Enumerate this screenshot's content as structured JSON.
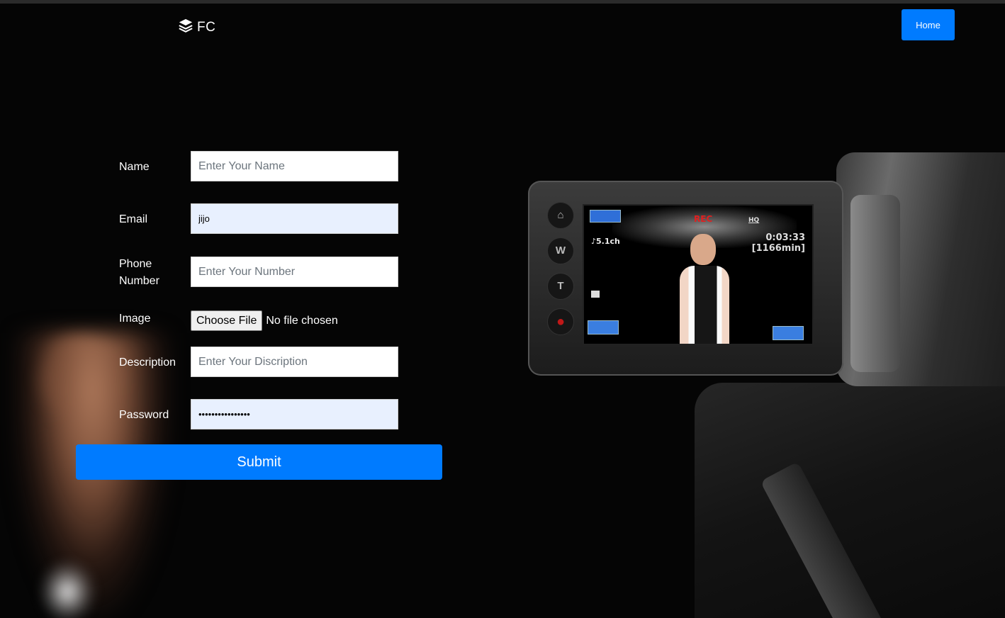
{
  "brand": {
    "text": "FC",
    "icon": "layers-icon"
  },
  "nav": {
    "home_label": "Home"
  },
  "form": {
    "name": {
      "label": "Name",
      "placeholder": "Enter Your Name",
      "value": ""
    },
    "email": {
      "label": "Email",
      "placeholder": "",
      "value": "jijo"
    },
    "phone": {
      "label_line1": "Phone",
      "label_line2": "Number",
      "placeholder": "Enter Your Number",
      "value": ""
    },
    "image": {
      "label": "Image",
      "button_label": "Choose File",
      "status": "No file chosen"
    },
    "description": {
      "label": "Description",
      "placeholder": "Enter Your Discription",
      "value": ""
    },
    "password": {
      "label": "Password",
      "value": "••••••••••••••••"
    },
    "submit_label": "Submit"
  },
  "camera_screen": {
    "rec": "REC",
    "hd": "HQ",
    "timecode": "0:03:33",
    "remaining": "[1166min]",
    "audio": "♪5.1ch"
  },
  "colors": {
    "primary": "#007bff",
    "autofill": "#e8f0fe",
    "background": "#050505"
  }
}
